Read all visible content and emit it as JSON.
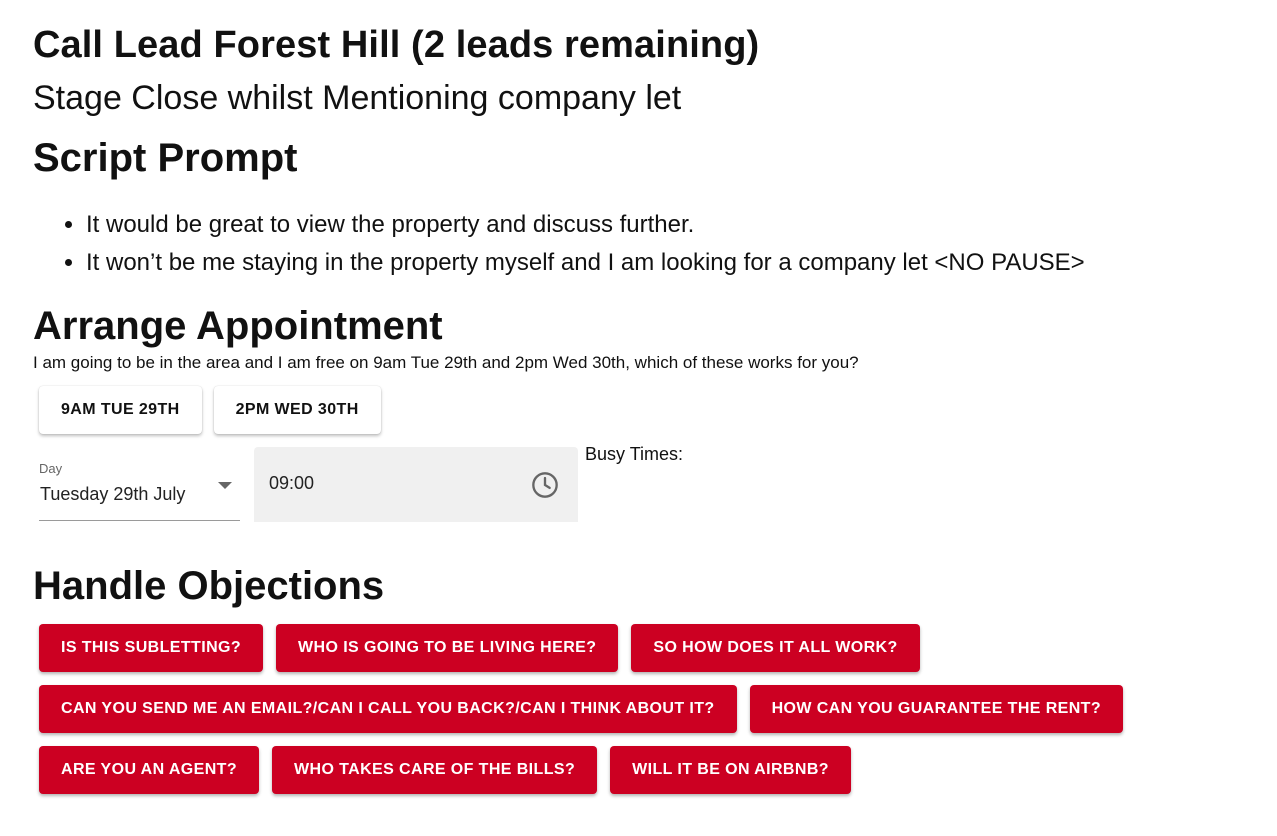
{
  "header": {
    "title": "Call Lead Forest Hill (2 leads remaining)",
    "stage": "Stage Close whilst Mentioning company let"
  },
  "script": {
    "heading": "Script Prompt",
    "items": [
      "It would be great to view the property and discuss further.",
      "It won’t be me staying in the property myself and I am looking for a company let <NO PAUSE>"
    ]
  },
  "appointment": {
    "heading": "Arrange Appointment",
    "text": "I am going to be in the area and I am free on 9am Tue 29th and 2pm Wed 30th, which of these works for you?",
    "slots": [
      "9AM TUE 29TH",
      "2PM WED 30TH"
    ],
    "day_label": "Day",
    "day_value": "Tuesday 29th July",
    "time_value": "09:00",
    "busy_times_label": "Busy Times:"
  },
  "objections": {
    "heading": "Handle Objections",
    "rows": [
      [
        "IS THIS SUBLETTING?",
        "WHO IS GOING TO BE LIVING HERE?",
        "SO HOW DOES IT ALL WORK?"
      ],
      [
        "CAN YOU SEND ME AN EMAIL?/CAN I CALL YOU BACK?/CAN I THINK ABOUT IT?",
        "HOW CAN YOU GUARANTEE THE RENT?"
      ],
      [
        "ARE YOU AN AGENT?",
        "WHO TAKES CARE OF THE BILLS?",
        "WILL IT BE ON AIRBNB?"
      ]
    ]
  },
  "colors": {
    "accent_red": "#cc0022",
    "field_background": "#f0f0f0"
  },
  "icons": {
    "time": "clock-icon",
    "day_select": "caret-down-icon"
  }
}
